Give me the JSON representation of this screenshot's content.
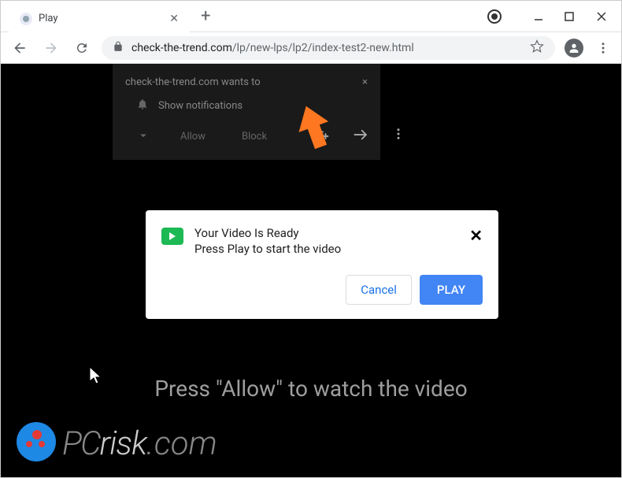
{
  "tab": {
    "title": "Play"
  },
  "url": {
    "domain": "check-the-trend.com",
    "path": "/lp/new-lps/lp2/index-test2-new.html"
  },
  "notification": {
    "header": "check-the-trend.com wants to",
    "row_label": "Show notifications",
    "allow_label": "Allow",
    "block_label": "Block",
    "close_glyph": "×"
  },
  "dialog": {
    "title": "Your Video Is Ready",
    "subtitle": "Press Play to start the video",
    "cancel_label": "Cancel",
    "play_label": "PLAY",
    "close_glyph": "✕"
  },
  "bottom_text": "Press \"Allow\" to watch the video",
  "watermark": {
    "pc": "PC",
    "risk": "risk",
    "com": ".com"
  }
}
